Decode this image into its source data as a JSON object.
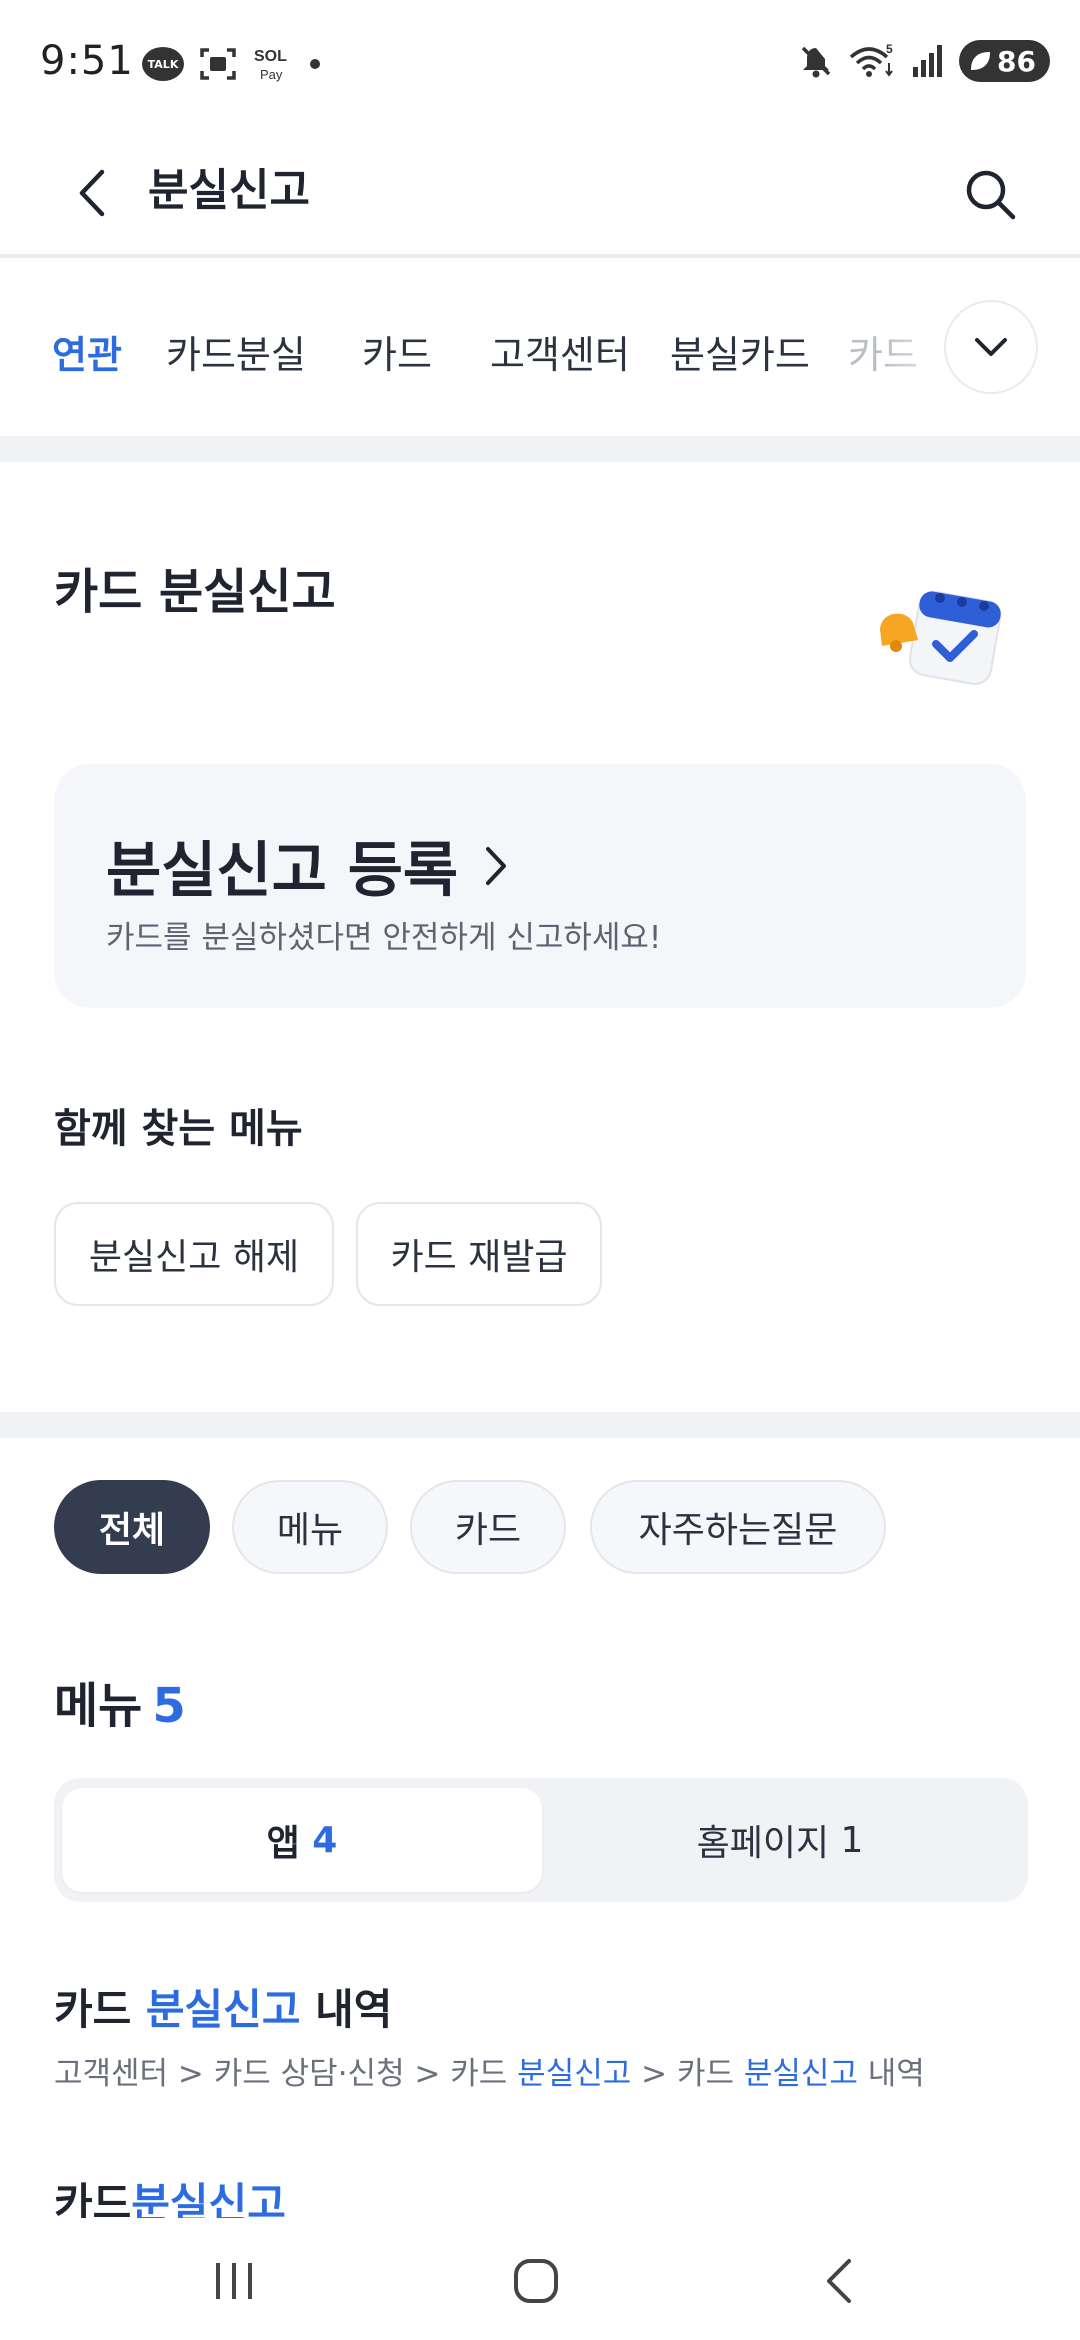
{
  "status_bar": {
    "time": "9:51",
    "left_icons": [
      "talk-icon",
      "screenshot-icon",
      "sol-pay-icon",
      "notification-dot"
    ],
    "talk_label": "TALK",
    "sol_pay_label": "SOL Pay",
    "right_icons": [
      "mute-icon",
      "wifi-5g-icon",
      "signal-icon"
    ],
    "battery_level": "86"
  },
  "header": {
    "title": "분실신고"
  },
  "keywords": {
    "items": [
      "연관",
      "카드분실",
      "카드",
      "고객센터",
      "분실카드",
      "카드"
    ],
    "active_index": 0
  },
  "featured": {
    "title": "카드 분실신고",
    "card_title": "분실신고 등록",
    "card_subtitle": "카드를 분실하셨다면 안전하게 신고하세요!"
  },
  "related": {
    "title": "함께 찾는 메뉴",
    "chips": [
      "분실신고 해제",
      "카드 재발급"
    ]
  },
  "filters": {
    "items": [
      "전체",
      "메뉴",
      "카드",
      "자주하는질문"
    ],
    "active_index": 0
  },
  "menu_section": {
    "label": "메뉴",
    "count": "5",
    "tabs": [
      {
        "label": "앱",
        "count": "4"
      },
      {
        "label": "홈페이지",
        "count": "1"
      }
    ]
  },
  "results": [
    {
      "title_parts": [
        "카드 ",
        "분실신고",
        " 내역"
      ],
      "path_parts": [
        "고객센터 > 카드 상담·신청 > 카드 ",
        "분실신고",
        " > 카드 ",
        "분실신고",
        " 내역"
      ]
    },
    {
      "title_parts": [
        "카드",
        "분실신고"
      ]
    }
  ],
  "colors": {
    "accent": "#2d6ce0",
    "dark_pill": "#333d4f",
    "band": "#f0f2f6"
  }
}
